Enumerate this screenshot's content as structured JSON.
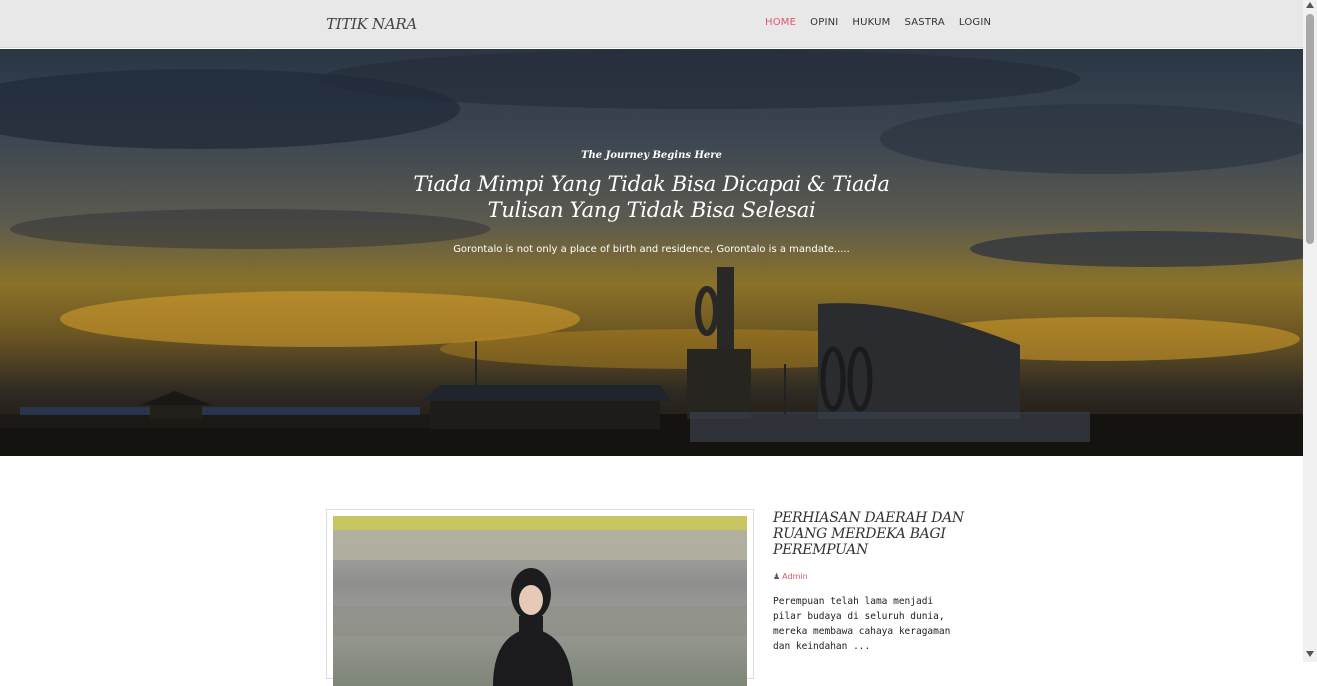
{
  "navbar": {
    "brand": "TITIK NARA",
    "items": [
      {
        "label": "HOME",
        "active": true
      },
      {
        "label": "OPINI",
        "active": false
      },
      {
        "label": "HUKUM",
        "active": false
      },
      {
        "label": "SASTRA",
        "active": false
      },
      {
        "label": "LOGIN",
        "active": false
      }
    ]
  },
  "hero": {
    "eyebrow": "The Journey Begins Here",
    "title": "Tiada Mimpi Yang Tidak Bisa Dicapai & Tiada Tulisan Yang Tidak Bisa Selesai",
    "subtitle": "Gorontalo is not only a place of birth and residence, Gorontalo is a mandate....."
  },
  "post": {
    "title": "PERHIASAN DAERAH DAN RUANG MERDEKA BAGI PEREMPUAN",
    "author_icon": "user-icon",
    "author": "Admin",
    "excerpt": "Perempuan telah lama menjadi pilar budaya di seluruh dunia, mereka membawa cahaya keragaman dan keindahan ..."
  },
  "colors": {
    "accent": "#e0576a",
    "navbar_bg": "#e8e8e8",
    "text": "#333333"
  }
}
